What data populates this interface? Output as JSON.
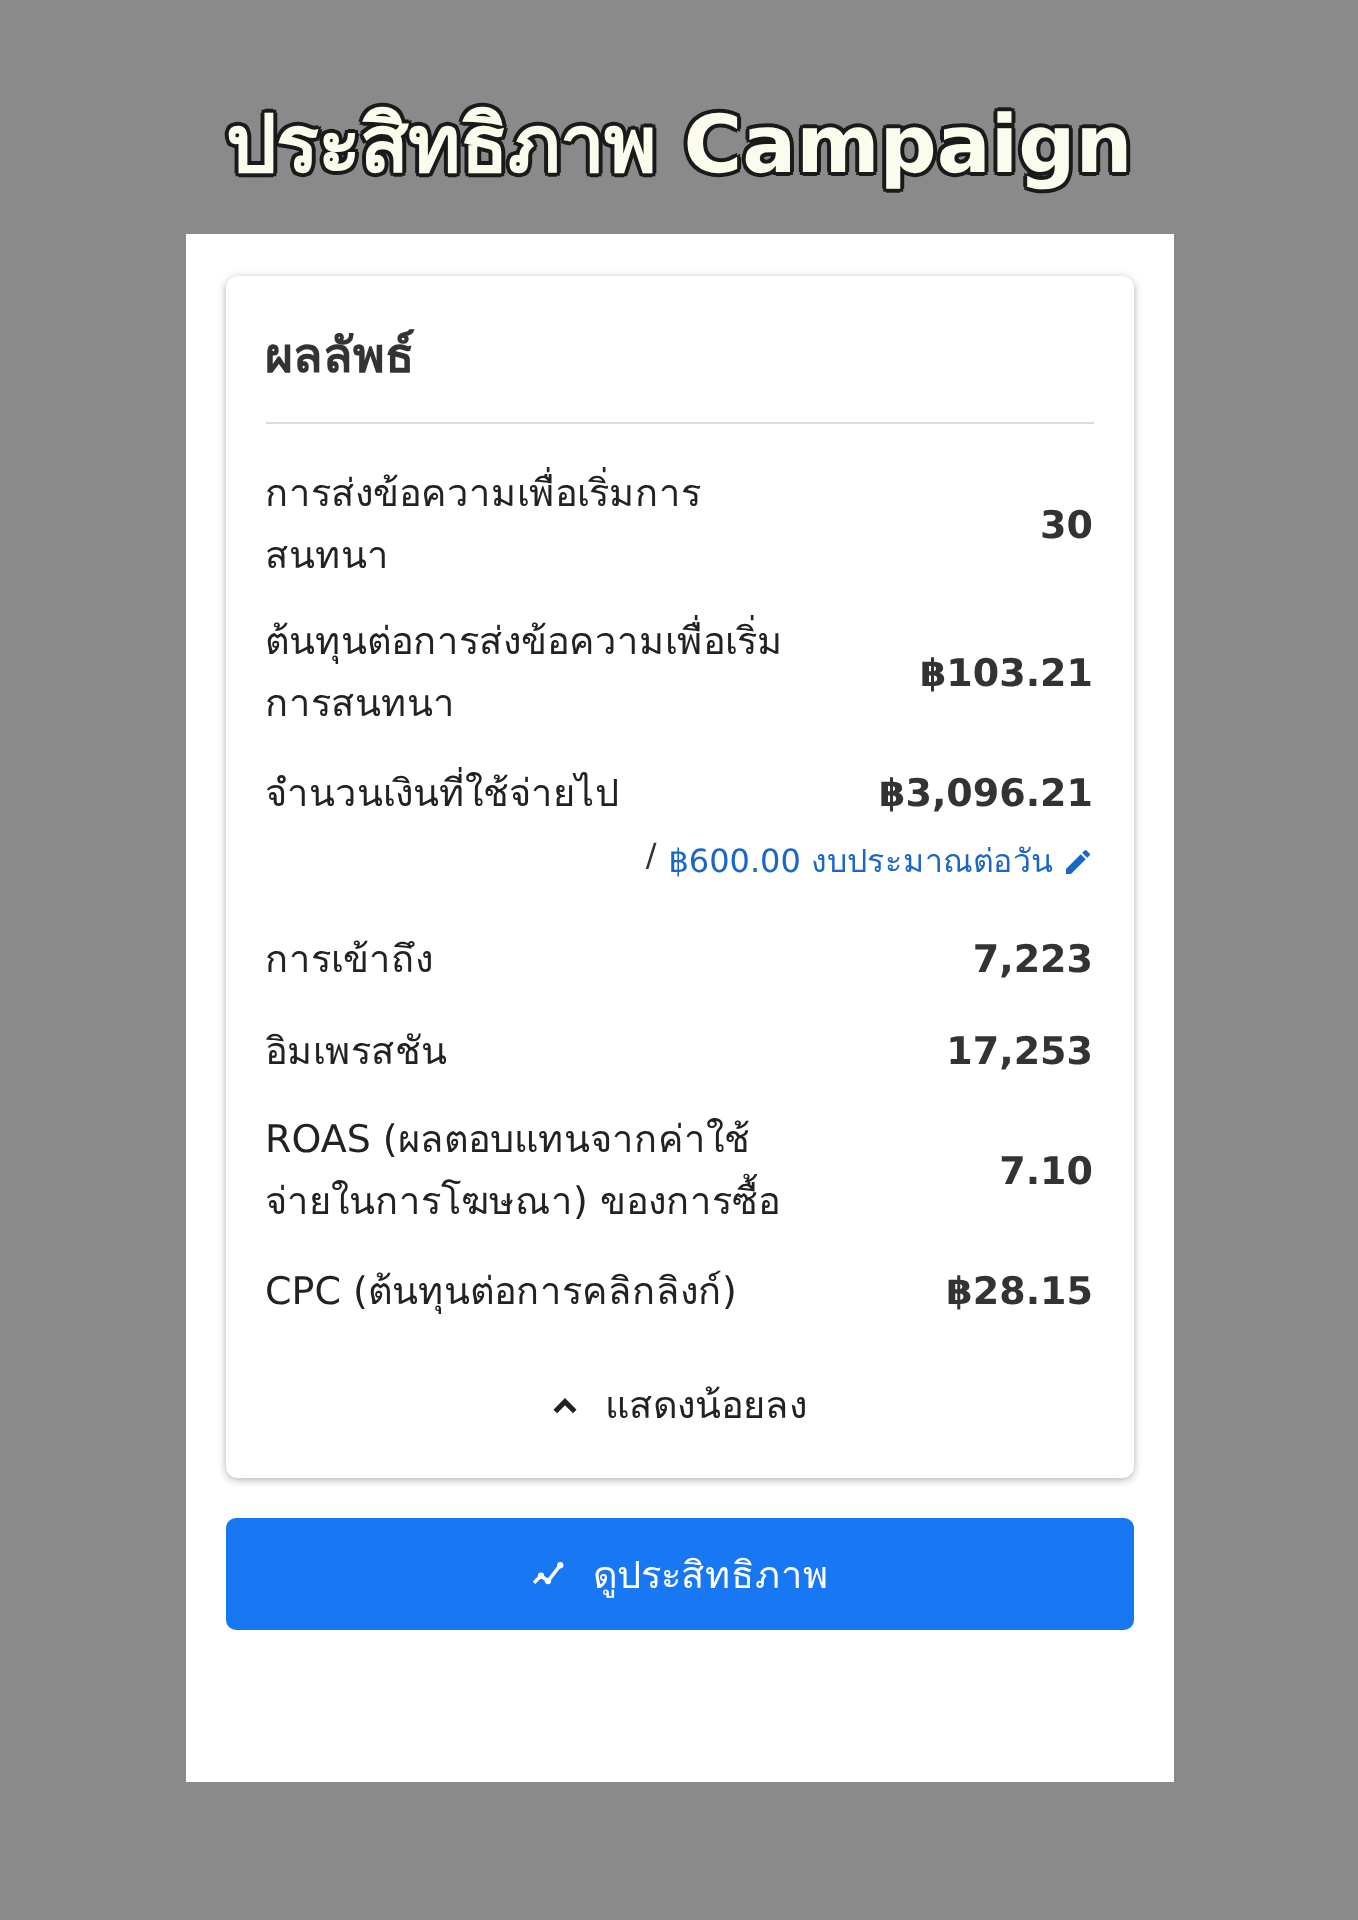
{
  "title": "ประสิทธิภาพ Campaign",
  "card": {
    "heading": "ผลลัพธ์",
    "rows": [
      {
        "label": "การส่งข้อความเพื่อเริ่มการสนทนา",
        "value": "30"
      },
      {
        "label": "ต้นทุนต่อการส่งข้อความเพื่อเริ่มการสนทนา",
        "value": "฿103.21"
      },
      {
        "label": "จำนวนเงินที่ใช้จ่ายไป",
        "value": "฿3,096.21",
        "budget": {
          "separator": "/",
          "link": "฿600.00 งบประมาณต่อวัน"
        }
      },
      {
        "label": "การเข้าถึง",
        "value": "7,223"
      },
      {
        "label": "อิมเพรสชัน",
        "value": "17,253"
      },
      {
        "label": "ROAS (ผลตอบแทนจากค่าใช้จ่ายในการโฆษณา) ของการซื้อ",
        "value": "7.10"
      },
      {
        "label": "CPC (ต้นทุนต่อการคลิกลิงก์)",
        "value": "฿28.15"
      }
    ],
    "toggle": "แสดงน้อยลง"
  },
  "button": "ดูประสิทธิภาพ"
}
